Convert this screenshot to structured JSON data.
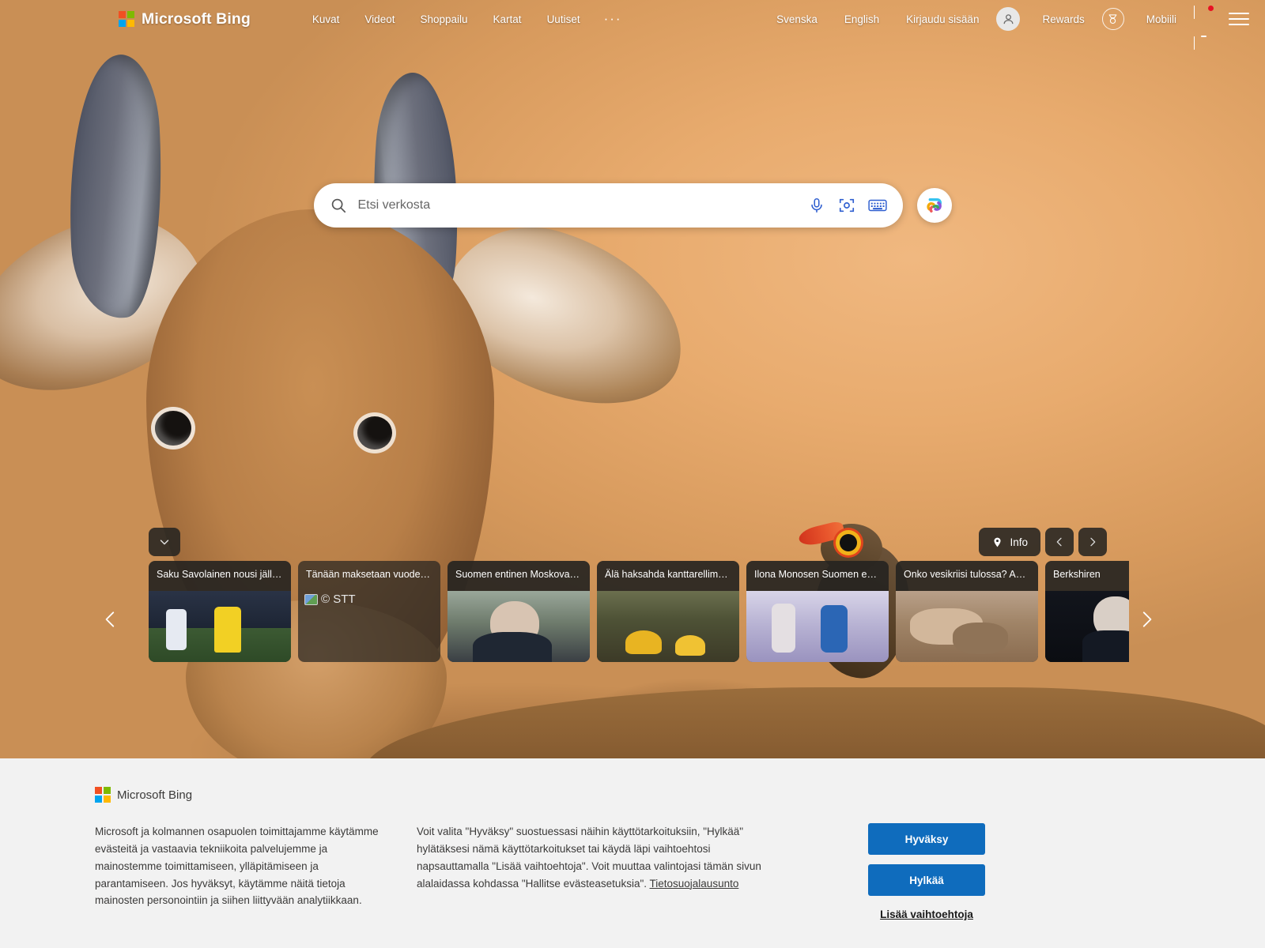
{
  "header": {
    "brand": "Microsoft Bing",
    "logo_colors": [
      "#f25022",
      "#7fba00",
      "#00a4ef",
      "#ffb900"
    ],
    "nav_left": [
      {
        "label": "Kuvat",
        "name": "nav-images"
      },
      {
        "label": "Videot",
        "name": "nav-videos"
      },
      {
        "label": "Shoppailu",
        "name": "nav-shopping"
      },
      {
        "label": "Kartat",
        "name": "nav-maps"
      },
      {
        "label": "Uutiset",
        "name": "nav-news"
      }
    ],
    "more_label": "···",
    "nav_right": {
      "lang_swedish": "Svenska",
      "lang_english": "English",
      "sign_in": "Kirjaudu sisään",
      "rewards": "Rewards",
      "mobile": "Mobiili"
    }
  },
  "search": {
    "placeholder": "Etsi verkosta",
    "value": "",
    "icons": [
      "search-icon",
      "microphone-icon",
      "visual-search-icon",
      "keyboard-icon"
    ],
    "copilot": "copilot-icon",
    "accent": "#2f5fd0"
  },
  "carousel": {
    "info_label": "Info",
    "expand_icon": "chevron-down-icon",
    "prev_icon": "chevron-left-icon",
    "next_icon": "chevron-right-icon",
    "cards": [
      {
        "title": "Saku Savolainen nousi jäll…",
        "thumb": "t-soccer",
        "translucent": false,
        "broken": false
      },
      {
        "title": "Tänään maksetaan vuode…",
        "thumb": "",
        "translucent": true,
        "broken": true,
        "broken_text": "© STT"
      },
      {
        "title": "Suomen entinen Moskova…",
        "thumb": "t-man",
        "translucent": false,
        "broken": false
      },
      {
        "title": "Älä haksahda kanttarellim…",
        "thumb": "t-mush",
        "translucent": false,
        "broken": false
      },
      {
        "title": "Ilona Monosen Suomen e…",
        "thumb": "t-run",
        "translucent": false,
        "broken": false
      },
      {
        "title": "Onko vesikriisi tulossa? A…",
        "thumb": "t-dry",
        "translucent": false,
        "broken": false
      },
      {
        "title": "Berkshiren",
        "thumb": "t-suit",
        "translucent": false,
        "broken": false
      }
    ]
  },
  "cookie_banner": {
    "brand": "Microsoft Bing",
    "paragraph_left": "Microsoft ja kolmannen osapuolen toimittajamme käytämme evästeitä ja vastaavia tekniikoita palvelujemme ja mainostemme toimittamiseen, ylläpitämiseen ja parantamiseen. Jos hyväksyt, käytämme näitä tietoja mainosten personointiin ja siihen liittyvään analytiikkaan.",
    "paragraph_right": "Voit valita \"Hyväksy\" suostuessasi näihin käyttötarkoituksiin, \"Hylkää\" hylätäksesi nämä käyttötarkoitukset tai käydä läpi vaihtoehtosi napsauttamalla \"Lisää vaihtoehtoja\". Voit muuttaa valintojasi tämän sivun alalaidassa kohdassa \"Hallitse evästeasetuksia\". ",
    "privacy_link": "Tietosuojalausunto",
    "accept_label": "Hyväksy",
    "reject_label": "Hylkää",
    "more_options_label": "Lisää vaihtoehtoja",
    "button_color": "#0f6cbd"
  }
}
